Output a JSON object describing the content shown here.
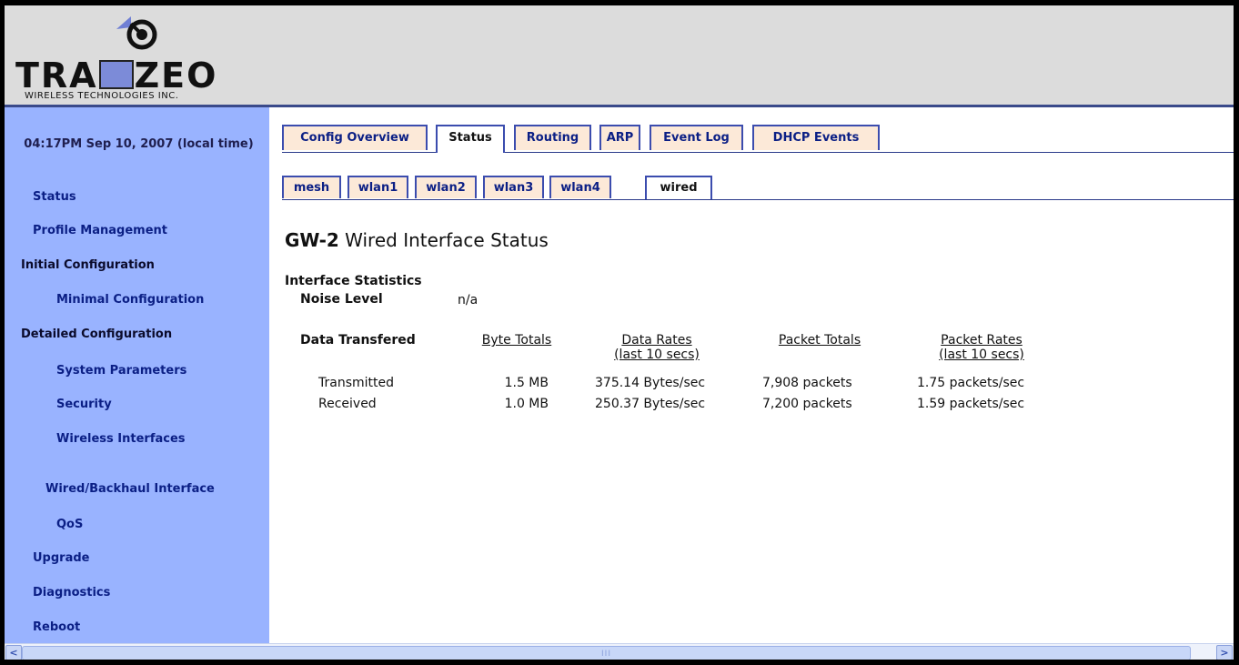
{
  "brand": {
    "name_part1": "TRA",
    "name_part2": "ZEO",
    "subtitle": "WIRELESS TECHNOLOGIES INC."
  },
  "sidebar": {
    "time": "04:17PM Sep 10, 2007 (local time)",
    "items": [
      {
        "label": "Status"
      },
      {
        "label": "Profile Management"
      },
      {
        "label": "Initial Configuration"
      },
      {
        "label": "Minimal Configuration"
      },
      {
        "label": "Detailed Configuration"
      },
      {
        "label": "System Parameters"
      },
      {
        "label": "Security"
      },
      {
        "label": "Wireless Interfaces"
      },
      {
        "label": "Wired/Backhaul Interface"
      },
      {
        "label": "QoS"
      },
      {
        "label": "Upgrade"
      },
      {
        "label": "Diagnostics"
      },
      {
        "label": "Reboot"
      }
    ]
  },
  "tabs": [
    {
      "label": "Config Overview"
    },
    {
      "label": "Status"
    },
    {
      "label": "Routing"
    },
    {
      "label": "ARP"
    },
    {
      "label": "Event Log"
    },
    {
      "label": "DHCP Events"
    }
  ],
  "subtabs": [
    {
      "label": "mesh"
    },
    {
      "label": "wlan1"
    },
    {
      "label": "wlan2"
    },
    {
      "label": "wlan3"
    },
    {
      "label": "wlan4"
    },
    {
      "label": "wired"
    }
  ],
  "page": {
    "title_node": "GW-2",
    "title_rest": "Wired Interface Status",
    "section": "Interface Statistics",
    "noise_label": "Noise Level",
    "noise_value": "n/a",
    "data_label": "Data Transfered"
  },
  "table": {
    "headers": [
      {
        "line1": "Byte Totals",
        "line2": ""
      },
      {
        "line1": "Data Rates",
        "line2": "(last 10 secs)"
      },
      {
        "line1": "Packet Totals",
        "line2": ""
      },
      {
        "line1": "Packet Rates",
        "line2": "(last 10 secs)"
      }
    ],
    "rows": [
      {
        "label": "Transmitted",
        "bytes": "1.5 MB",
        "data_rate": "375.14 Bytes/sec",
        "packets": "7,908 packets",
        "packet_rate": "1.75 packets/sec"
      },
      {
        "label": "Received",
        "bytes": "1.0 MB",
        "data_rate": "250.37 Bytes/sec",
        "packets": "7,200 packets",
        "packet_rate": "1.59 packets/sec"
      }
    ]
  },
  "scrollbar": {
    "left_arrow": "<",
    "right_arrow": ">",
    "grip": "III"
  },
  "colors": {
    "sidebar_bg": "#99b3ff",
    "tab_bg": "#fce9d8",
    "link": "#0b1f85",
    "header_bg": "#dcdcdc"
  }
}
